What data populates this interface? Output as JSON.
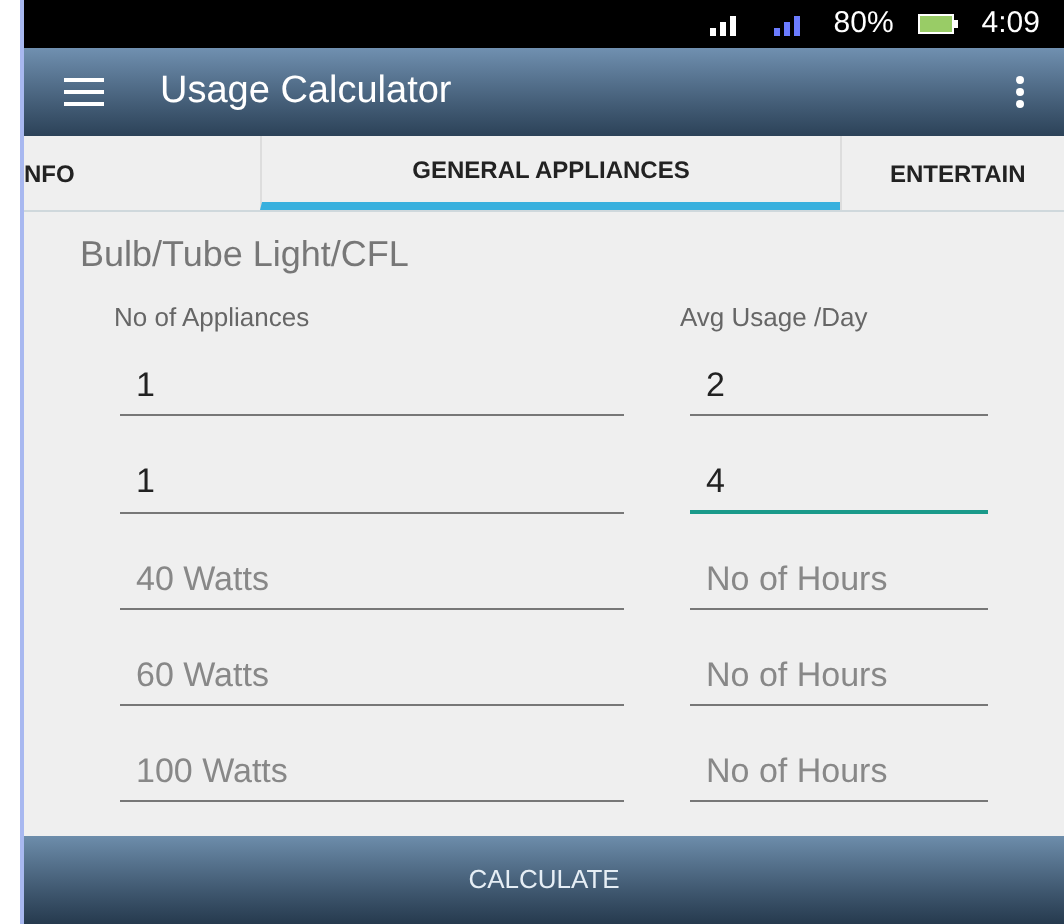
{
  "status_bar": {
    "battery": "80%",
    "time": "4:09"
  },
  "app_bar": {
    "title": "Usage Calculator"
  },
  "tabs": [
    {
      "label": "NFO",
      "selected": false
    },
    {
      "label": "GENERAL APPLIANCES",
      "selected": true
    },
    {
      "label": "ENTERTAIN",
      "selected": false
    }
  ],
  "section": {
    "title": "Bulb/Tube Light/CFL",
    "columns": [
      "No of Appliances",
      "Avg Usage /Day"
    ],
    "rows": [
      {
        "appliances": {
          "value": "1",
          "focused": false
        },
        "usage": {
          "value": "2",
          "focused": false
        }
      },
      {
        "appliances": {
          "value": "1",
          "focused": false
        },
        "usage": {
          "value": "4",
          "focused": true
        }
      },
      {
        "appliances": {
          "placeholder": "40 Watts",
          "focused": false
        },
        "usage": {
          "placeholder": "No of Hours",
          "focused": false
        }
      },
      {
        "appliances": {
          "placeholder": "60 Watts",
          "focused": false
        },
        "usage": {
          "placeholder": "No of Hours",
          "focused": false
        }
      },
      {
        "appliances": {
          "placeholder": "100 Watts",
          "focused": false
        },
        "usage": {
          "placeholder": "No of Hours",
          "focused": false
        }
      }
    ]
  },
  "button": "CALCULATE"
}
